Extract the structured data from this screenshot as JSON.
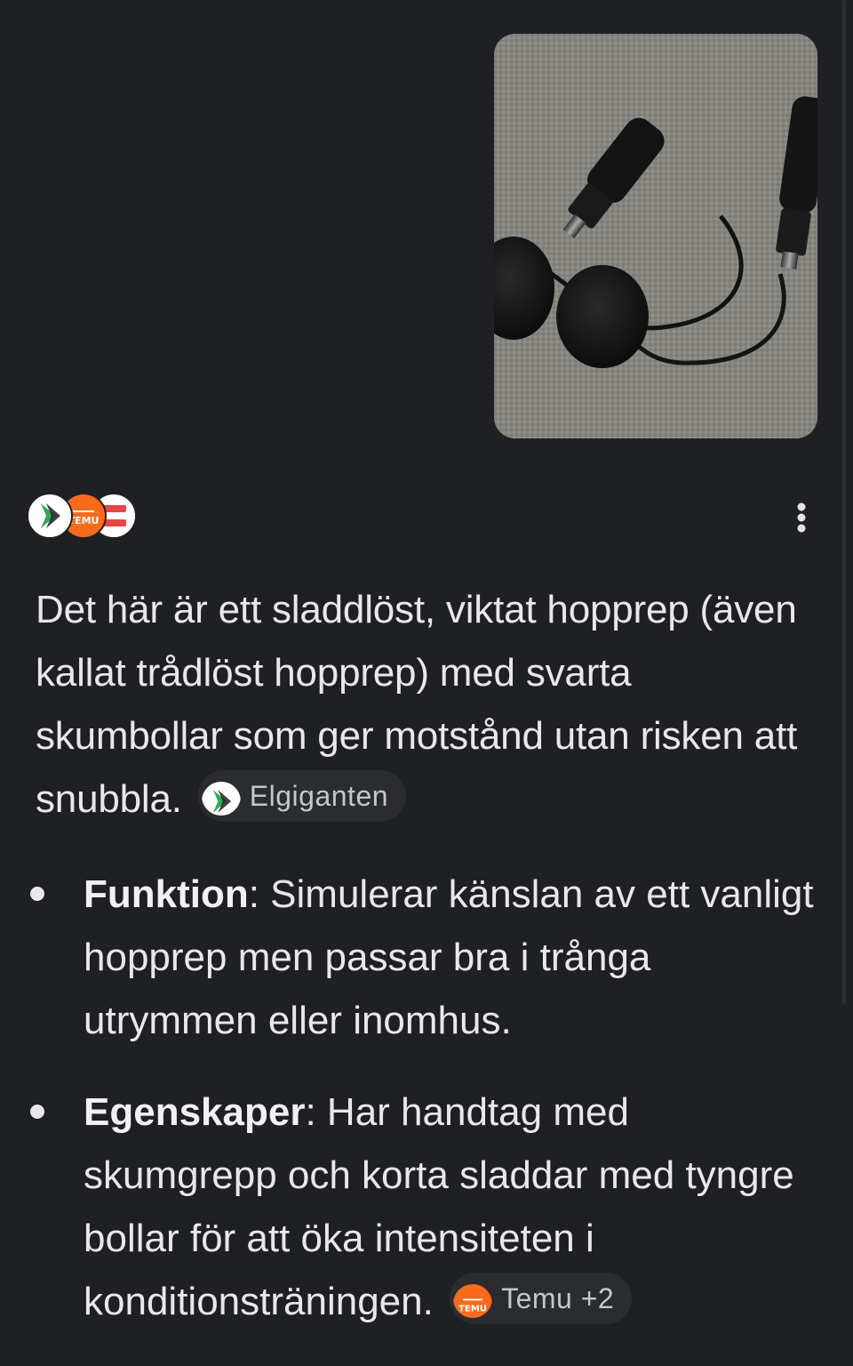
{
  "image": {
    "alt": "photo-of-cordless-jump-rope"
  },
  "sources": {
    "icons": [
      "elgiganten-logo",
      "temu-logo",
      "third-source-logo"
    ]
  },
  "menu": {
    "icon": "more-vert-icon"
  },
  "answer": {
    "paragraph": "Det här är ett sladdlöst, viktat hopprep (även kallat trådlöst hopprep) med svarta skumbollar som ger motstånd utan risken att snubbla.",
    "citation": {
      "label": "Elgiganten",
      "icon": "elgiganten-logo"
    }
  },
  "bullets": [
    {
      "term": "Funktion",
      "text": ": Simulerar känslan av ett vanligt hopprep men passar bra i trånga utrymmen eller inomhus."
    },
    {
      "term": "Egenskaper",
      "text": ": Har handtag med skumgrepp och korta sladdar med tyngre bollar för att öka intensiteten i konditionsträningen.",
      "citation": {
        "label": "Temu +2",
        "icon": "temu-logo"
      }
    }
  ],
  "colors": {
    "background": "#1f2024",
    "text": "#e8e8ea",
    "chip_background": "#2b2c30",
    "chip_text": "#c4c6cc",
    "temu_orange": "#f86b1c",
    "elgiganten_green": "#2fa84f"
  }
}
